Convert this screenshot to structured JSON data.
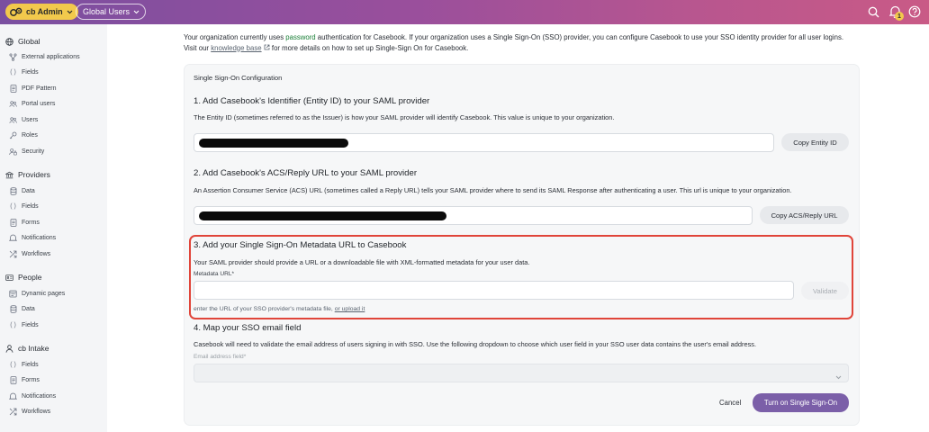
{
  "topbar": {
    "app_label": "cb Admin",
    "workspace_label": "Global Users",
    "notifications_count": "1",
    "colors": {
      "brand_yellow": "#f2c94c",
      "gradient_start": "#7a4fa0",
      "gradient_end": "#c95a86"
    }
  },
  "sidebar": {
    "sections": [
      {
        "label": "Global",
        "icon": "globe-icon",
        "items": [
          {
            "label": "External applications",
            "icon": "branch-icon"
          },
          {
            "label": "Fields",
            "icon": "braces-icon"
          },
          {
            "label": "PDF Pattern",
            "icon": "document-icon"
          },
          {
            "label": "Portal users",
            "icon": "users-icon"
          },
          {
            "label": "Users",
            "icon": "users-icon"
          },
          {
            "label": "Roles",
            "icon": "key-icon"
          },
          {
            "label": "Security",
            "icon": "user-lock-icon"
          }
        ]
      },
      {
        "label": "Providers",
        "icon": "building-icon",
        "items": [
          {
            "label": "Data",
            "icon": "database-icon"
          },
          {
            "label": "Fields",
            "icon": "braces-icon"
          },
          {
            "label": "Forms",
            "icon": "document-icon"
          },
          {
            "label": "Notifications",
            "icon": "bell-icon"
          },
          {
            "label": "Workflows",
            "icon": "workflow-icon"
          }
        ]
      },
      {
        "label": "People",
        "icon": "id-card-icon",
        "items": [
          {
            "label": "Dynamic pages",
            "icon": "page-icon"
          },
          {
            "label": "Data",
            "icon": "database-icon"
          },
          {
            "label": "Fields",
            "icon": "braces-icon"
          }
        ]
      },
      {
        "label": "cb Intake",
        "icon": "person-icon",
        "items": [
          {
            "label": "Fields",
            "icon": "braces-icon"
          },
          {
            "label": "Forms",
            "icon": "document-icon"
          },
          {
            "label": "Notifications",
            "icon": "bell-icon"
          },
          {
            "label": "Workflows",
            "icon": "workflow-icon"
          }
        ]
      }
    ]
  },
  "intro": {
    "line1_prefix": "Your organization currently uses ",
    "auth_method": "password",
    "line1_suffix": " authentication for Casebook. If your organization uses a Single Sign-On (SSO) provider, you can configure Casebook to use your SSO identity provider for all user logins.",
    "line2_prefix": "Visit our ",
    "link_text": "knowledge base",
    "line2_suffix": " for more details on how to set up Single-Sign On for Casebook."
  },
  "card": {
    "title": "Single Sign-On Configuration",
    "step1": {
      "heading": "1. Add Casebook's Identifier (Entity ID) to your SAML provider",
      "description": "The Entity ID (sometimes referred to as the Issuer) is how your SAML provider will identify Casebook. This value is unique to your organization.",
      "button": "Copy Entity ID"
    },
    "step2": {
      "heading": "2. Add Casebook's ACS/Reply URL to your SAML provider",
      "description": "An Assertion Consumer Service (ACS) URL (sometimes called a Reply URL) tells your SAML provider where to send its SAML Response after authenticating a user. This url is unique to your organization.",
      "button": "Copy ACS/Reply URL"
    },
    "step3": {
      "heading": "3. Add your Single Sign-On Metadata URL to Casebook",
      "description": "Your SAML provider should provide a URL or a downloadable file with XML-formatted metadata for your user data.",
      "field_label": "Metadata URL*",
      "field_value": "",
      "button": "Validate",
      "hint_prefix": "enter the URL of your SSO provider's metadata file, ",
      "hint_link": "or upload it"
    },
    "step4": {
      "heading": "4. Map your SSO email field",
      "description": "Casebook will need to validate the email address of users signing in with SSO. Use the following dropdown to choose which user field in your SSO user data contains the user's email address.",
      "field_label": "Email address field*",
      "field_value": ""
    },
    "cancel": "Cancel",
    "submit": "Turn on Single Sign-On",
    "colors": {
      "primary": "#7b5fa8",
      "highlight_border": "#e0453a",
      "auth_method_text": "#1a7f37"
    }
  }
}
